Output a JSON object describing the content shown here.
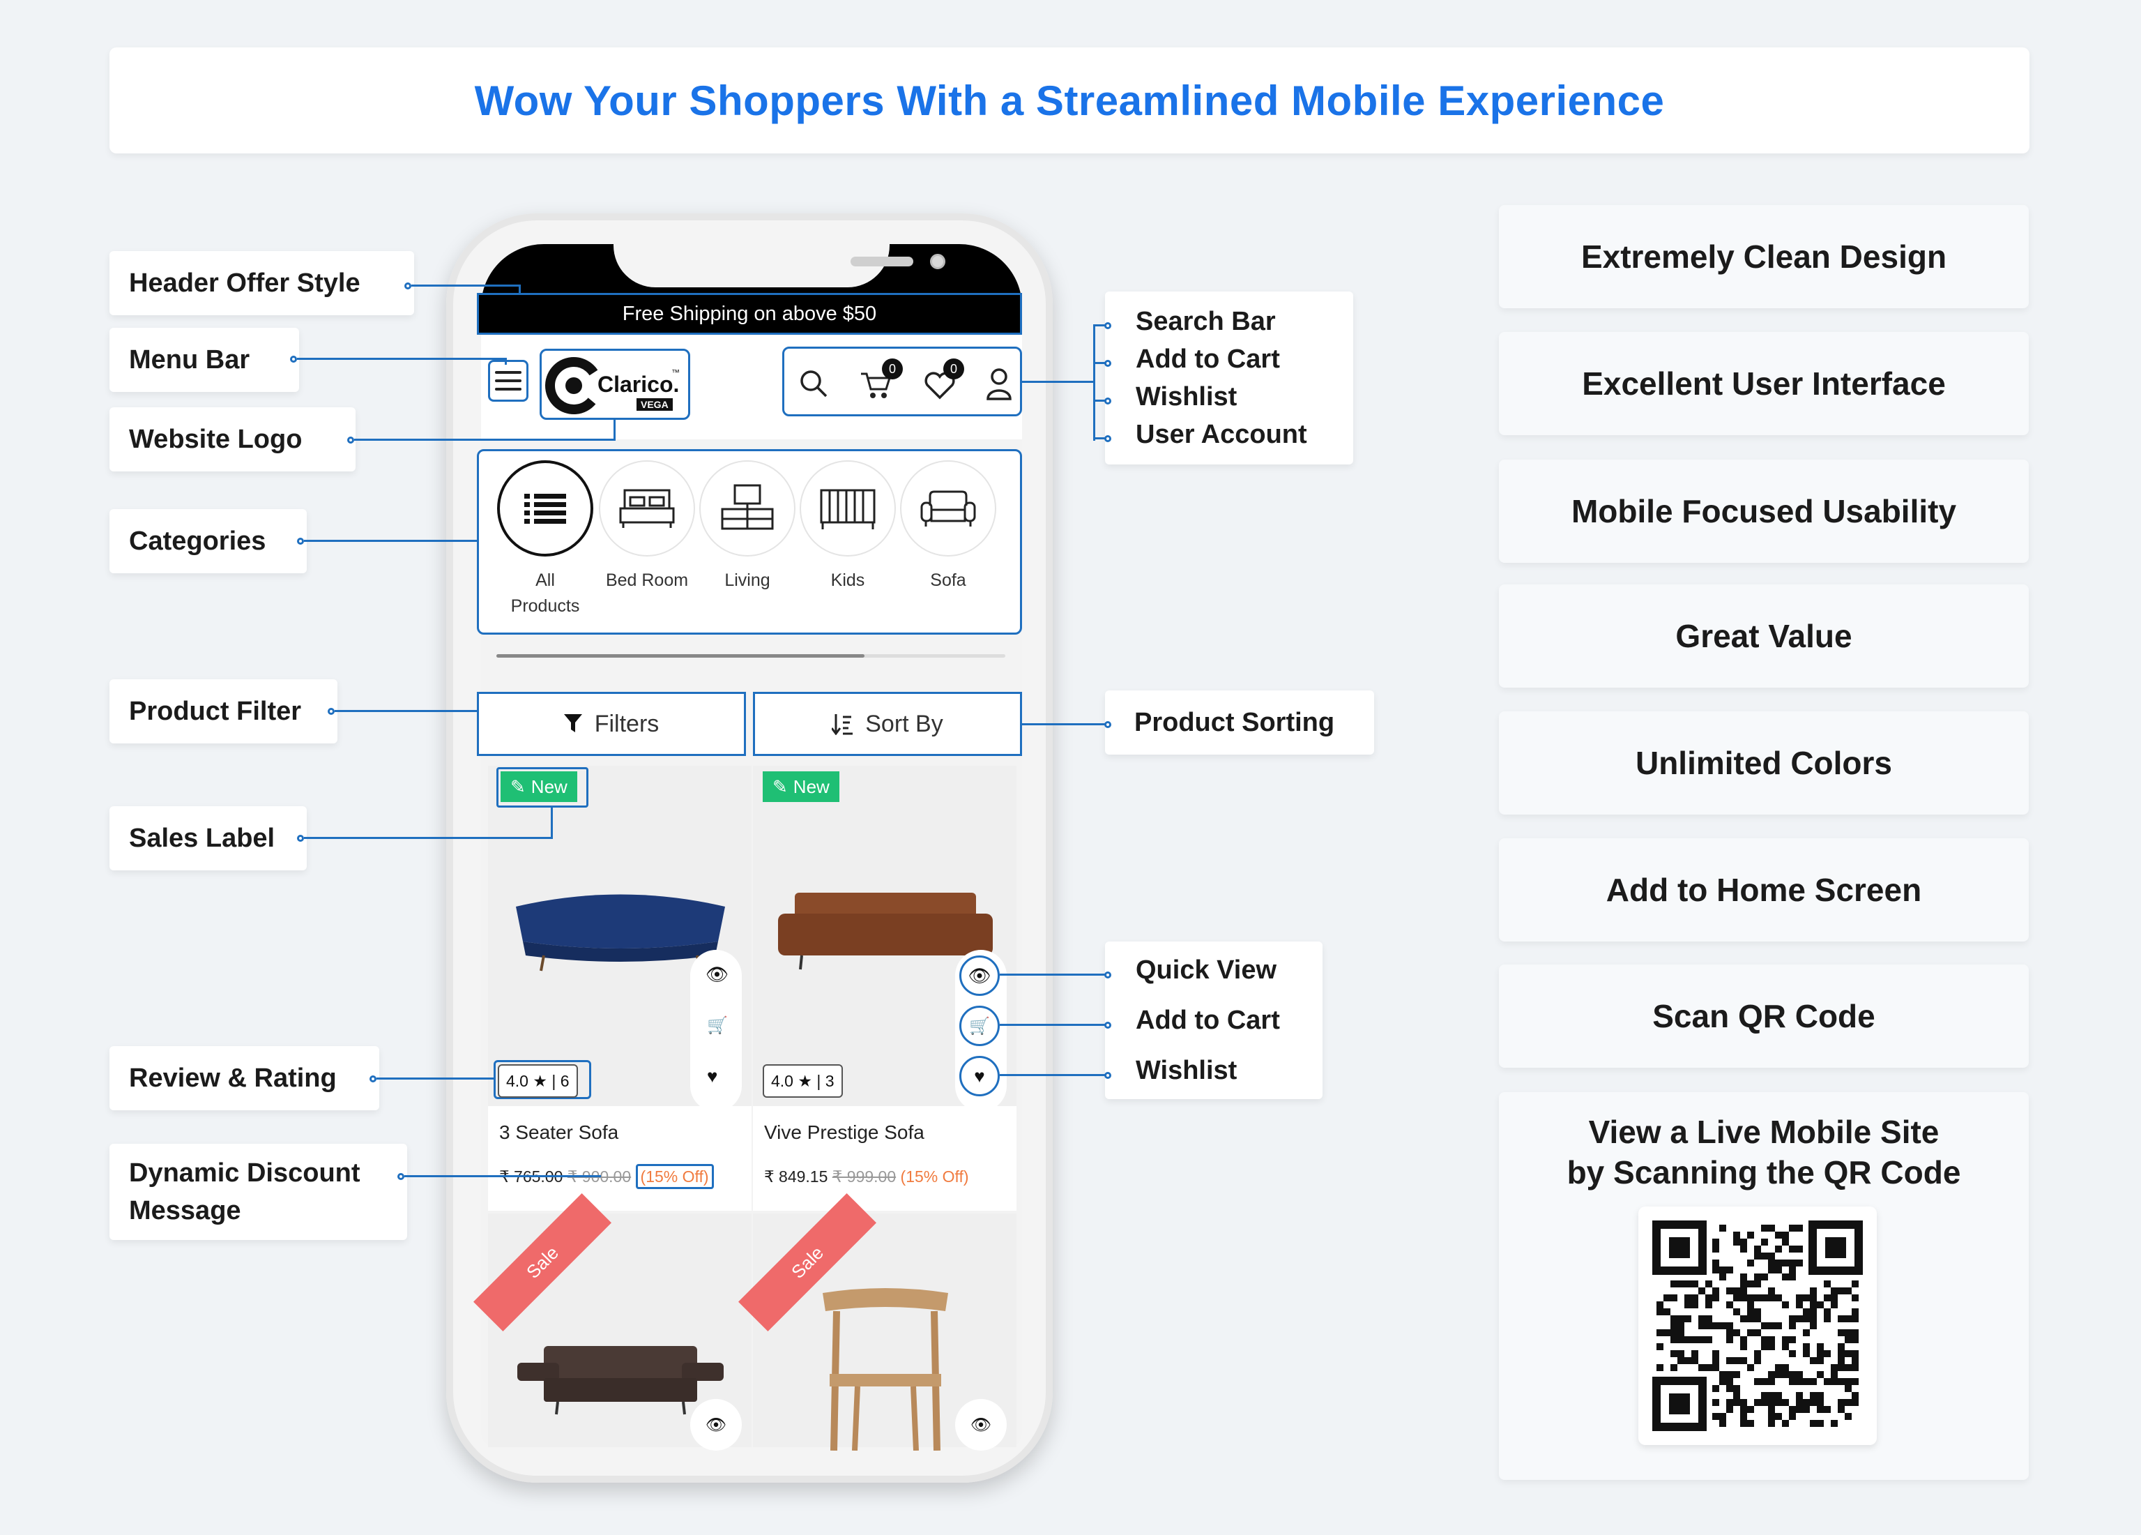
{
  "headline": "Wow Your Shoppers With a Streamlined Mobile Experience",
  "left_labels": {
    "header_offer": "Header Offer Style",
    "menu_bar": "Menu Bar",
    "website_logo": "Website Logo",
    "categories": "Categories",
    "product_filter": "Product Filter",
    "sales_label": "Sales Label",
    "review_rating": "Review & Rating",
    "dynamic_discount_1": "Dynamic Discount",
    "dynamic_discount_2": "Message"
  },
  "right_labels": {
    "search_bar": "Search Bar",
    "add_to_cart": "Add to Cart",
    "wishlist": "Wishlist",
    "user_account": "User Account",
    "product_sorting": "Product Sorting",
    "quick_view": "Quick View",
    "add_to_cart_2": "Add to Cart",
    "wishlist_2": "Wishlist"
  },
  "features": [
    "Extremely Clean Design",
    "Excellent User Interface",
    "Mobile Focused Usability",
    "Great Value",
    "Unlimited Colors",
    "Add to Home Screen",
    "Scan QR Code"
  ],
  "qr_card": {
    "line1": "View a Live Mobile Site",
    "line2": "by Scanning the QR Code"
  },
  "phone": {
    "offer_text": "Free Shipping on above $50",
    "logo_text": "Clarico.",
    "logo_tm": "™",
    "logo_badge": "VEGA",
    "cart_count": "0",
    "wishlist_count": "0",
    "categories": [
      {
        "label1": "All",
        "label2": "Products"
      },
      {
        "label1": "Bed Room",
        "label2": ""
      },
      {
        "label1": "Living",
        "label2": ""
      },
      {
        "label1": "Kids",
        "label2": ""
      },
      {
        "label1": "Sofa",
        "label2": ""
      }
    ],
    "filter_label": "Filters",
    "sort_label": "Sort By",
    "products": [
      {
        "tag": "New",
        "rating": "4.0 ★ | 6",
        "name": "3 Seater Sofa",
        "price": "₹ 765.00",
        "old_price": "₹ 900.00",
        "discount": "(15% Off)"
      },
      {
        "tag": "New",
        "rating": "4.0 ★ | 3",
        "name": "Vive Prestige Sofa",
        "price": "₹ 849.15",
        "old_price": "₹ 999.00",
        "discount": "(15% Off)"
      }
    ],
    "sale_label": "Sale"
  },
  "colors": {
    "accent": "#1a73e8",
    "line": "#1f6fbf",
    "new_tag": "#1fbf74",
    "sale_ribbon": "#ef6a6a",
    "discount": "#f07b3f"
  }
}
